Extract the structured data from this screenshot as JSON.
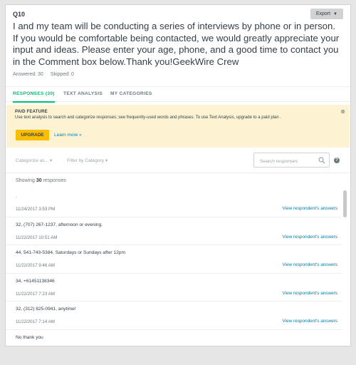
{
  "question": {
    "number": "Q10",
    "text": "I and my team will be conducting a series of interviews by phone or in person. If you would be comfortable being contacted, we would greatly appreciate your input and ideas. Please enter your age, phone, and a good time to contact you in the Comment box below.Thank you!GeekWire Crew",
    "answered": "Answered: 30",
    "skipped": "Skipped: 0"
  },
  "export": {
    "label": "Export",
    "icon": "caret-down-icon"
  },
  "tabs": [
    {
      "label": "RESPONSES (30)",
      "active": true
    },
    {
      "label": "TEXT ANALYSIS",
      "active": false
    },
    {
      "label": "MY CATEGORIES",
      "active": false
    }
  ],
  "paid_feature": {
    "title": "PAID FEATURE",
    "description": "Use text analysis to search and categorize responses; see frequently-used words and phrases. To use Text Analysis, upgrade to a paid plan .",
    "upgrade_label": "UPGRADE",
    "learn_more": "Learn more »",
    "close_icon": "close-icon"
  },
  "filters": {
    "categorize": "Categorize as...",
    "filter_by_category": "Filter by Category",
    "search_placeholder": "Search responses"
  },
  "showing": {
    "prefix": "Showing",
    "count": "30",
    "suffix": "responses"
  },
  "responses": [
    {
      "text": ".",
      "date": "11/24/2017 3:53 PM",
      "link": "View respondent's answers"
    },
    {
      "text": "32, (707) 267-1237, afternoon or evening.",
      "date": "11/22/2017 10:51 AM",
      "link": "View respondent's answers"
    },
    {
      "text": "44, 541-743-5384, Saturdays or Sundays after 12pm",
      "date": "11/22/2017 9:46 AM",
      "link": "View respondent's answers"
    },
    {
      "text": "34, +61451138346",
      "date": "11/22/2017 7:23 AM",
      "link": "View respondent's answers"
    },
    {
      "text": "32, (312) 825-0941, anytime!",
      "date": "11/22/2017 7:14 AM",
      "link": "View respondent's answers"
    },
    {
      "text": "No thank you",
      "date": "",
      "link": ""
    }
  ],
  "colors": {
    "accent": "#00bf6f",
    "link": "#007faa",
    "paid_bg": "#fdf3d3",
    "upgrade": "#f9be00"
  }
}
